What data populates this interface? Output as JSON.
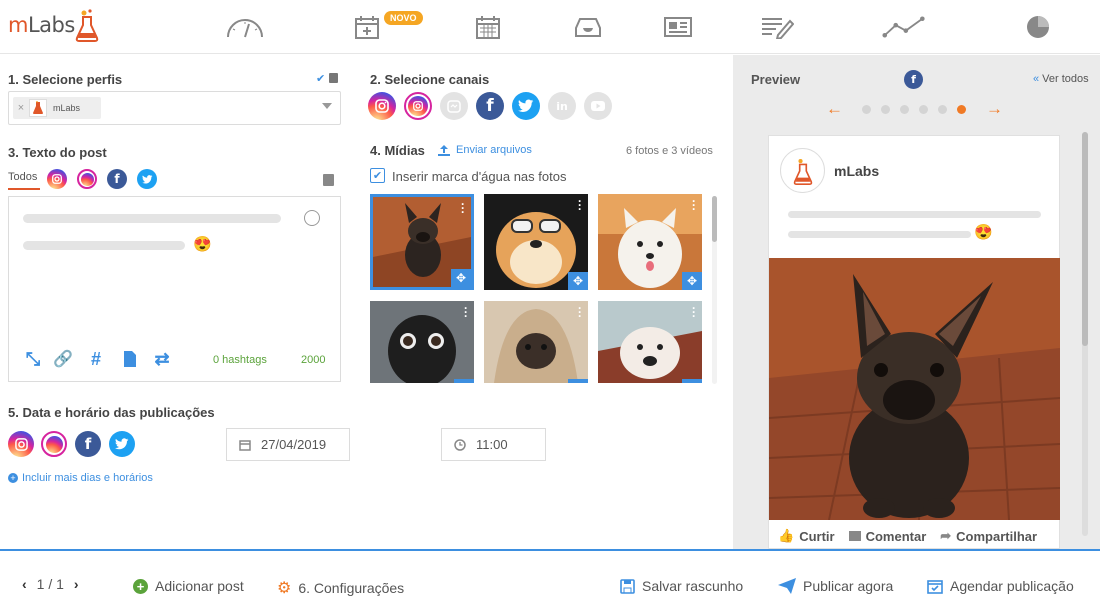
{
  "brand": {
    "logo_prefix": "m",
    "logo_text": "Labs",
    "accent": "#e0572a",
    "blue": "#3d8fe0"
  },
  "nav": {
    "icons": [
      "dashboard-gauge-icon",
      "calendar-add-icon",
      "calendar-grid-icon",
      "inbox-tray-icon",
      "newspaper-icon",
      "report-edit-icon",
      "line-chart-icon",
      "pie-chart-icon"
    ],
    "badge": "NOVO"
  },
  "profiles": {
    "title": "1. Selecione perfis",
    "selected_chip": "mLabs"
  },
  "channels": {
    "title": "2. Selecione canais",
    "items": [
      "instagram-icon",
      "instagram-stories-icon",
      "instagram-tv-icon",
      "facebook-icon",
      "twitter-icon",
      "linkedin-icon",
      "youtube-icon"
    ]
  },
  "post_text": {
    "title": "3. Texto do post",
    "tab_all": "Todos",
    "emoji": "😍",
    "hashtags": "0 hashtags",
    "char_count": "2000"
  },
  "media": {
    "title": "4. Mídias",
    "upload_link": "Enviar arquivos",
    "count": "6 fotos e 3 vídeos",
    "watermark_label": "Inserir marca d'água nas fotos",
    "watermark_checked": true
  },
  "schedule": {
    "title": "5. Data e horário das publicações",
    "date": "27/04/2019",
    "time": "11:00",
    "more_link": "Incluir mais dias e horários"
  },
  "preview": {
    "title": "Preview",
    "see_all": "Ver todos",
    "account": "mLabs",
    "emoji": "😍",
    "like": "Curtir",
    "comment": "Comentar",
    "share": "Compartilhar",
    "active_page": 6,
    "page_count": 6
  },
  "footer": {
    "pager": "1 / 1",
    "add_post": "Adicionar post",
    "settings": "6. Configurações",
    "save_draft": "Salvar rascunho",
    "publish_now": "Publicar agora",
    "schedule": "Agendar publicação"
  }
}
